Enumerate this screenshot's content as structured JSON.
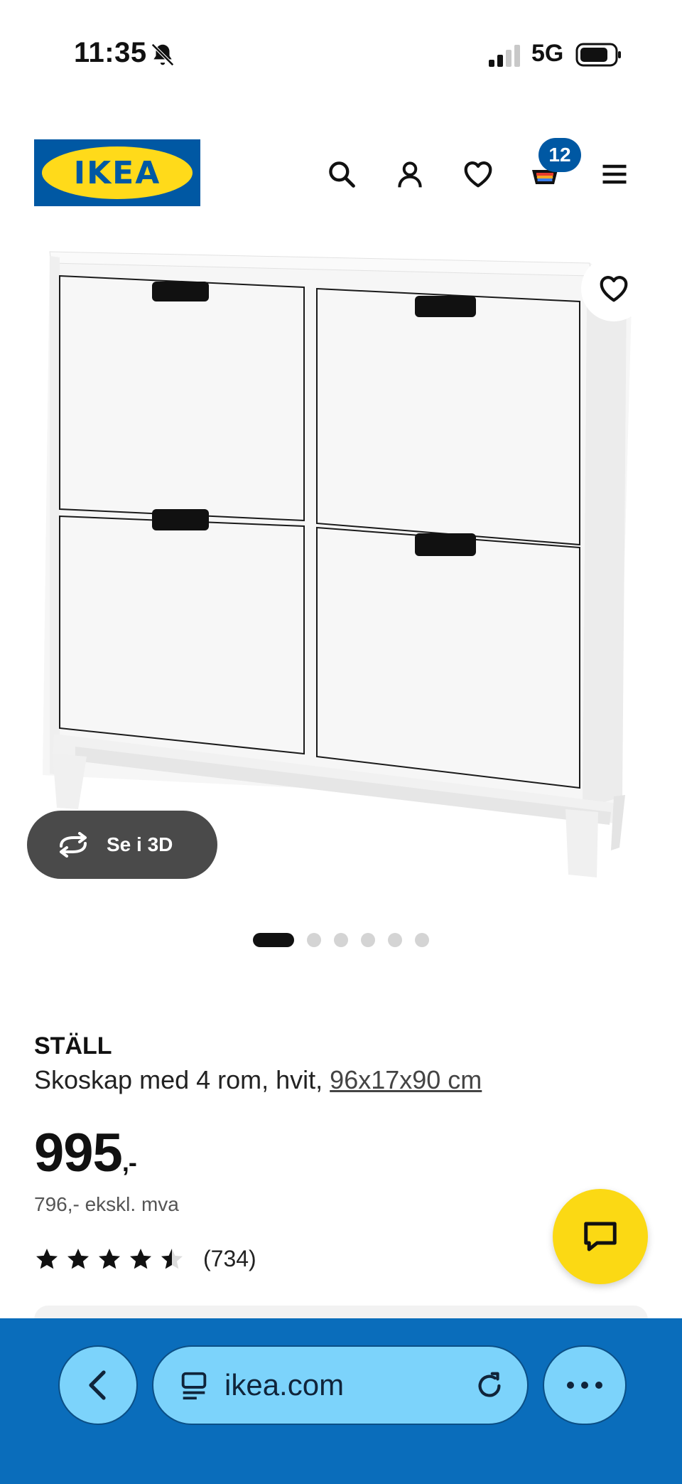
{
  "status_bar": {
    "time": "11:35",
    "network": "5G"
  },
  "header": {
    "logo_text": "IKEA",
    "cart_count": "12"
  },
  "gallery": {
    "view_3d_label": "Se i 3D",
    "dot_count": 6,
    "active_dot": 0
  },
  "product": {
    "brand": "STÄLL",
    "description": "Skoskap med 4 rom, hvit, ",
    "dimensions": "96x17x90 cm",
    "price": "995",
    "price_suffix": ",-",
    "price_excl_vat": "796,- ekskl. mva",
    "rating_value": 4.5,
    "rating_count": "(734)"
  },
  "browser": {
    "url": "ikea.com"
  },
  "colors": {
    "ikea_blue": "#0058a3",
    "ikea_yellow": "#ffda1a",
    "chat_yellow": "#fbd914",
    "browser_bar": "#0a6dbb",
    "browser_button": "#7cd3fb"
  }
}
